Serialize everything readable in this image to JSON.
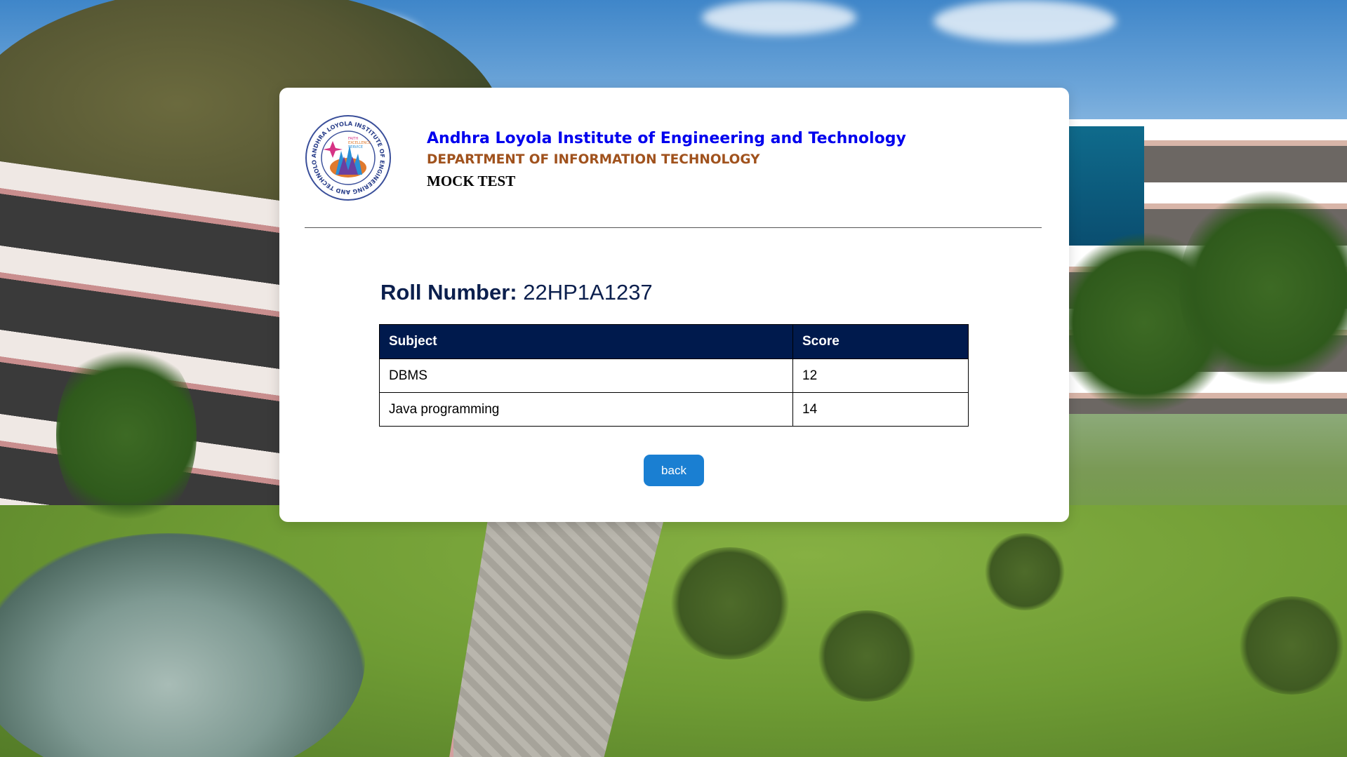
{
  "header": {
    "college_name": "Andhra Loyola Institute of Engineering and Technology",
    "department": "DEPARTMENT OF INFORMATION TECHNOLOGY",
    "test_title": "MOCK TEST",
    "logo": {
      "ring_text": "ANDHRA LOYOLA INSTITUTE OF ENGINEERING AND TECHNOLOGY",
      "motto": [
        "FAITH",
        "EXCELLENCE",
        "SERVICE"
      ]
    }
  },
  "result": {
    "roll_label": "Roll Number:",
    "roll_value": "22HP1A1237",
    "columns": [
      "Subject",
      "Score"
    ],
    "rows": [
      {
        "subject": "DBMS",
        "score": "12"
      },
      {
        "subject": "Java programming",
        "score": "14"
      }
    ]
  },
  "actions": {
    "back_label": "back"
  },
  "colors": {
    "college_name": "#0000ee",
    "department": "#a0521d",
    "roll_text": "#0b1f4d",
    "table_header_bg": "#001a4d",
    "button_bg": "#1a7fd2"
  }
}
